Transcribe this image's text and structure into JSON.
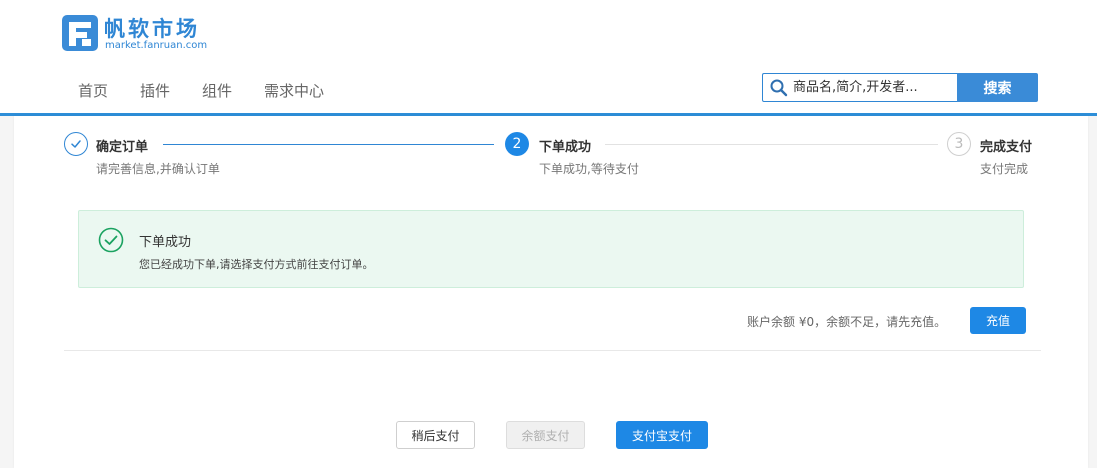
{
  "header": {
    "logo_title": "帆软市场",
    "logo_subtitle": "market.fanruan.com",
    "nav": [
      {
        "label": "首页"
      },
      {
        "label": "插件"
      },
      {
        "label": "组件"
      },
      {
        "label": "需求中心"
      }
    ],
    "search": {
      "placeholder": "商品名,简介,开发者...",
      "button_label": "搜索"
    }
  },
  "steps": [
    {
      "number": "✓",
      "title": "确定订单",
      "desc": "请完善信息,并确认订单",
      "state": "done"
    },
    {
      "number": "2",
      "title": "下单成功",
      "desc": "下单成功,等待支付",
      "state": "active"
    },
    {
      "number": "3",
      "title": "完成支付",
      "desc": "支付完成",
      "state": "pending"
    }
  ],
  "message": {
    "title": "下单成功",
    "text": "您已经成功下单,请选择支付方式前往支付订单。"
  },
  "balance": {
    "text": "账户余额 ¥0，余额不足，请先充值。",
    "recharge_label": "充值"
  },
  "actions": {
    "pay_later": "稍后支付",
    "balance_pay": "余额支付",
    "alipay": "支付宝支付"
  },
  "colors": {
    "brand": "#2f86d4",
    "primary": "#1e88e5",
    "success": "#1aa260",
    "message_bg": "#ebf8f1"
  }
}
